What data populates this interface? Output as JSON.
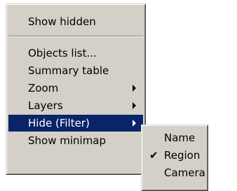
{
  "main_menu": {
    "items": [
      {
        "label": "Show hidden",
        "has_submenu": false
      },
      {
        "label": "Objects list...",
        "has_submenu": false
      },
      {
        "label": "Summary table",
        "has_submenu": false
      },
      {
        "label": "Zoom",
        "has_submenu": true
      },
      {
        "label": "Layers",
        "has_submenu": true
      },
      {
        "label": "Hide (Filter)",
        "has_submenu": true,
        "highlighted": true
      },
      {
        "label": "Show minimap",
        "has_submenu": false
      }
    ]
  },
  "sub_menu": {
    "items": [
      {
        "label": "Name",
        "checked": false
      },
      {
        "label": "Region",
        "checked": true
      },
      {
        "label": "Camera",
        "checked": false
      }
    ],
    "check_glyph": "✔"
  },
  "colors": {
    "menu_background": "#d4d0c8",
    "highlight_background": "#0a246a",
    "highlight_text": "#ffffff"
  },
  "icons": {
    "submenu_arrow": "chevron-right-icon",
    "check": "check-icon"
  }
}
